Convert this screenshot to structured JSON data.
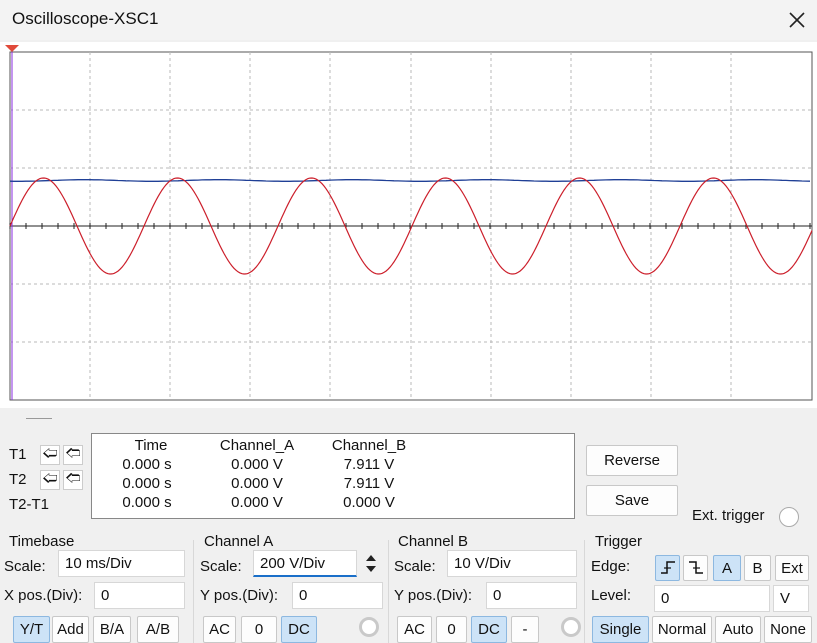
{
  "window": {
    "title": "Oscilloscope-XSC1"
  },
  "cursors": {
    "t1": "T1",
    "t2": "T2",
    "t2t1": "T2-T1"
  },
  "readout": {
    "headers": [
      "Time",
      "Channel_A",
      "Channel_B"
    ],
    "rows": [
      [
        "0.000 s",
        "0.000 V",
        "7.911 V"
      ],
      [
        "0.000 s",
        "0.000 V",
        "7.911 V"
      ],
      [
        "0.000 s",
        "0.000 V",
        "0.000 V"
      ]
    ]
  },
  "buttons": {
    "reverse": "Reverse",
    "save": "Save",
    "ext_trigger": "Ext. trigger"
  },
  "timebase": {
    "title": "Timebase",
    "scale_label": "Scale:",
    "scale_value": "10 ms/Div",
    "xpos_label": "X pos.(Div):",
    "xpos_value": "0",
    "modes": [
      "Y/T",
      "Add",
      "B/A",
      "A/B"
    ]
  },
  "channel_a": {
    "title": "Channel A",
    "scale_label": "Scale:",
    "scale_value": "200  V/Div",
    "ypos_label": "Y pos.(Div):",
    "ypos_value": "0",
    "coupling": [
      "AC",
      "0",
      "DC"
    ]
  },
  "channel_b": {
    "title": "Channel B",
    "scale_label": "Scale:",
    "scale_value": "10  V/Div",
    "ypos_label": "Y pos.(Div):",
    "ypos_value": "0",
    "coupling": [
      "AC",
      "0",
      "DC",
      "-"
    ]
  },
  "trigger": {
    "title": "Trigger",
    "edge_label": "Edge:",
    "level_label": "Level:",
    "level_value": "0",
    "level_unit": "V",
    "sources": [
      "A",
      "B",
      "Ext"
    ],
    "modes": [
      "Single",
      "Normal",
      "Auto",
      "None"
    ]
  },
  "colors": {
    "channel_a": "#cc1f2b",
    "channel_b": "#1f3f96",
    "active_button": "#cde3f7"
  }
}
